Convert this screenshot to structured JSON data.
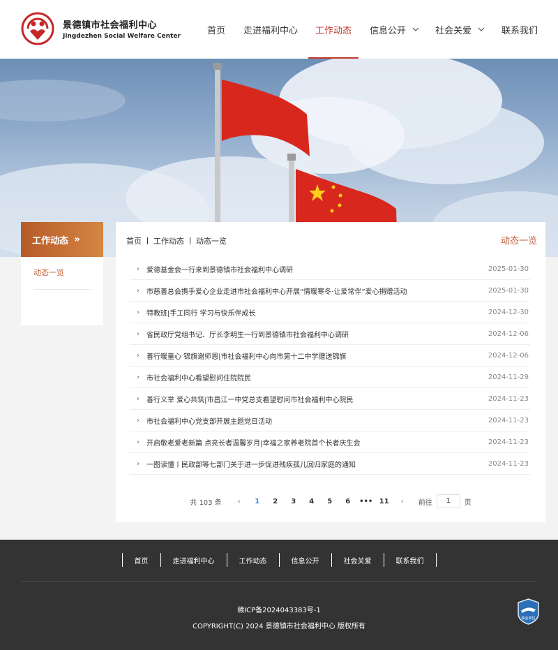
{
  "header": {
    "brand_cn": "景德镇市社会福利中心",
    "brand_en": "Jingdezhen Social Welfare Center",
    "nav": [
      {
        "label": "首页",
        "active": false,
        "dropdown": false
      },
      {
        "label": "走进福利中心",
        "active": false,
        "dropdown": false
      },
      {
        "label": "工作动态",
        "active": true,
        "dropdown": false
      },
      {
        "label": "信息公开",
        "active": false,
        "dropdown": true
      },
      {
        "label": "社会关爱",
        "active": false,
        "dropdown": true
      },
      {
        "label": "联系我们",
        "active": false,
        "dropdown": false
      }
    ]
  },
  "sidebar": {
    "title": "工作动态",
    "items": [
      {
        "label": "动态一览"
      }
    ]
  },
  "main": {
    "breadcrumb": [
      "首页",
      "工作动态",
      "动态一览"
    ],
    "panel_title": "动态一览",
    "articles": [
      {
        "title": "爱德基金会一行来到景德镇市社会福利中心调研",
        "date": "2025-01-30"
      },
      {
        "title": "市慈善总会携手爱心企业走进市社会福利中心开展“情暖寒冬·让爱常伴”爱心捐赠活动",
        "date": "2025-01-30"
      },
      {
        "title": "特教班|手工同行 学习与快乐伴成长",
        "date": "2024-12-30"
      },
      {
        "title": "省民政厅党组书记、厅长李明生一行到景德镇市社会福利中心调研",
        "date": "2024-12-06"
      },
      {
        "title": "善行暖童心 锦旗谢师恩|市社会福利中心向市第十二中学赠送锦旗",
        "date": "2024-12-06"
      },
      {
        "title": "市社会福利中心看望慰问住院院民",
        "date": "2024-11-29"
      },
      {
        "title": "善行义举 爱心共筑|市昌江一中党总支看望慰问市社会福利中心院民",
        "date": "2024-11-23"
      },
      {
        "title": "市社会福利中心党支部开展主题党日活动",
        "date": "2024-11-23"
      },
      {
        "title": "开启敬老爱老新篇 点亮长者温馨岁月|幸福之家养老院首个长者庆生会",
        "date": "2024-11-23"
      },
      {
        "title": "一图读懂丨民政部等七部门关于进一步促进残疾孤儿回归家庭的通知",
        "date": "2024-11-23"
      }
    ],
    "pagination": {
      "total_text": "共 103 条",
      "pages": [
        "1",
        "2",
        "3",
        "4",
        "5",
        "6",
        "•••",
        "11"
      ],
      "current": "1",
      "goto_label": "前往",
      "goto_value": "1",
      "page_suffix": "页"
    }
  },
  "footer": {
    "nav": [
      "首页",
      "走进福利中心",
      "工作动态",
      "信息公开",
      "社会关爱",
      "联系我们"
    ],
    "icp": "赣ICP备2024043383号-1",
    "copyright": "COPYRIGHT(C) 2024 景德镇市社会福利中心 版权所有",
    "badge_text": "事业单位"
  },
  "colors": {
    "accent": "#c0392b",
    "sidebar_gradient": [
      "#b65a2a",
      "#d58642"
    ],
    "link_accent": "#c0623b",
    "current_page": "#3a8ee6",
    "footer_bg": "#333333"
  }
}
